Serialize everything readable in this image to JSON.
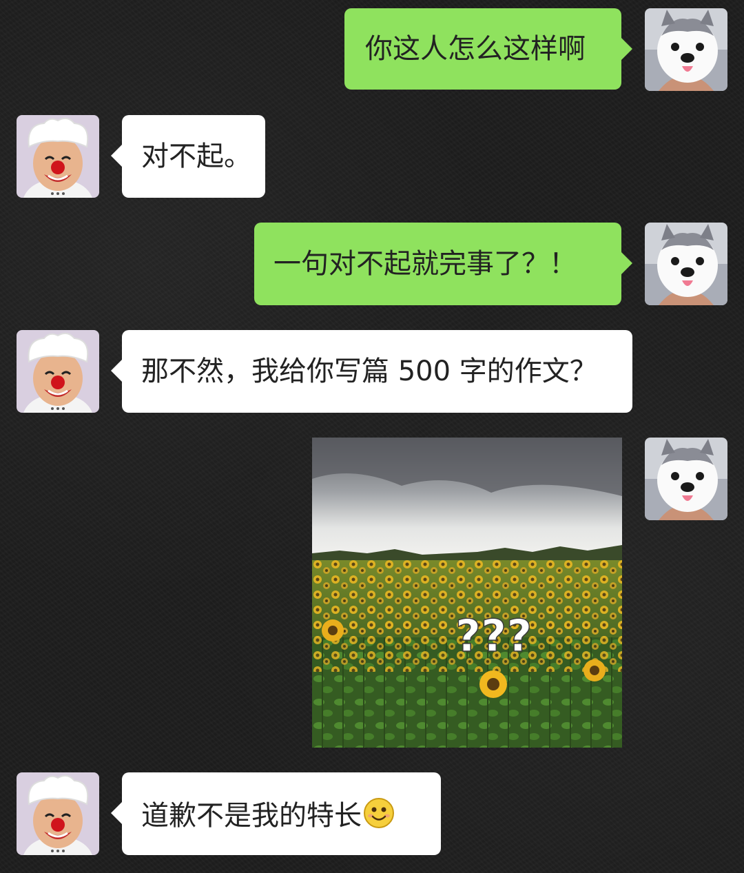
{
  "messages": [
    {
      "side": "me",
      "type": "text",
      "text": "你这人怎么这样啊"
    },
    {
      "side": "them",
      "type": "text",
      "text": "对不起。"
    },
    {
      "side": "me",
      "type": "text",
      "text": "一句对不起就完事了？！"
    },
    {
      "side": "them",
      "type": "text",
      "text": "那不然，我给你写篇 500 字的作文？"
    },
    {
      "side": "me",
      "type": "image",
      "image": "sunflower-field-question-marks",
      "overlay_text": "???"
    },
    {
      "side": "them",
      "type": "text",
      "text": "道歉不是我的特长",
      "emoji": "smiling-face-emoji"
    }
  ],
  "avatars": {
    "me": "husky-puppy-avatar",
    "them": "clown-chef-avatar"
  },
  "colors": {
    "my_bubble": "#8fe25e",
    "their_bubble": "#ffffff",
    "background": "#1e1e1e"
  }
}
